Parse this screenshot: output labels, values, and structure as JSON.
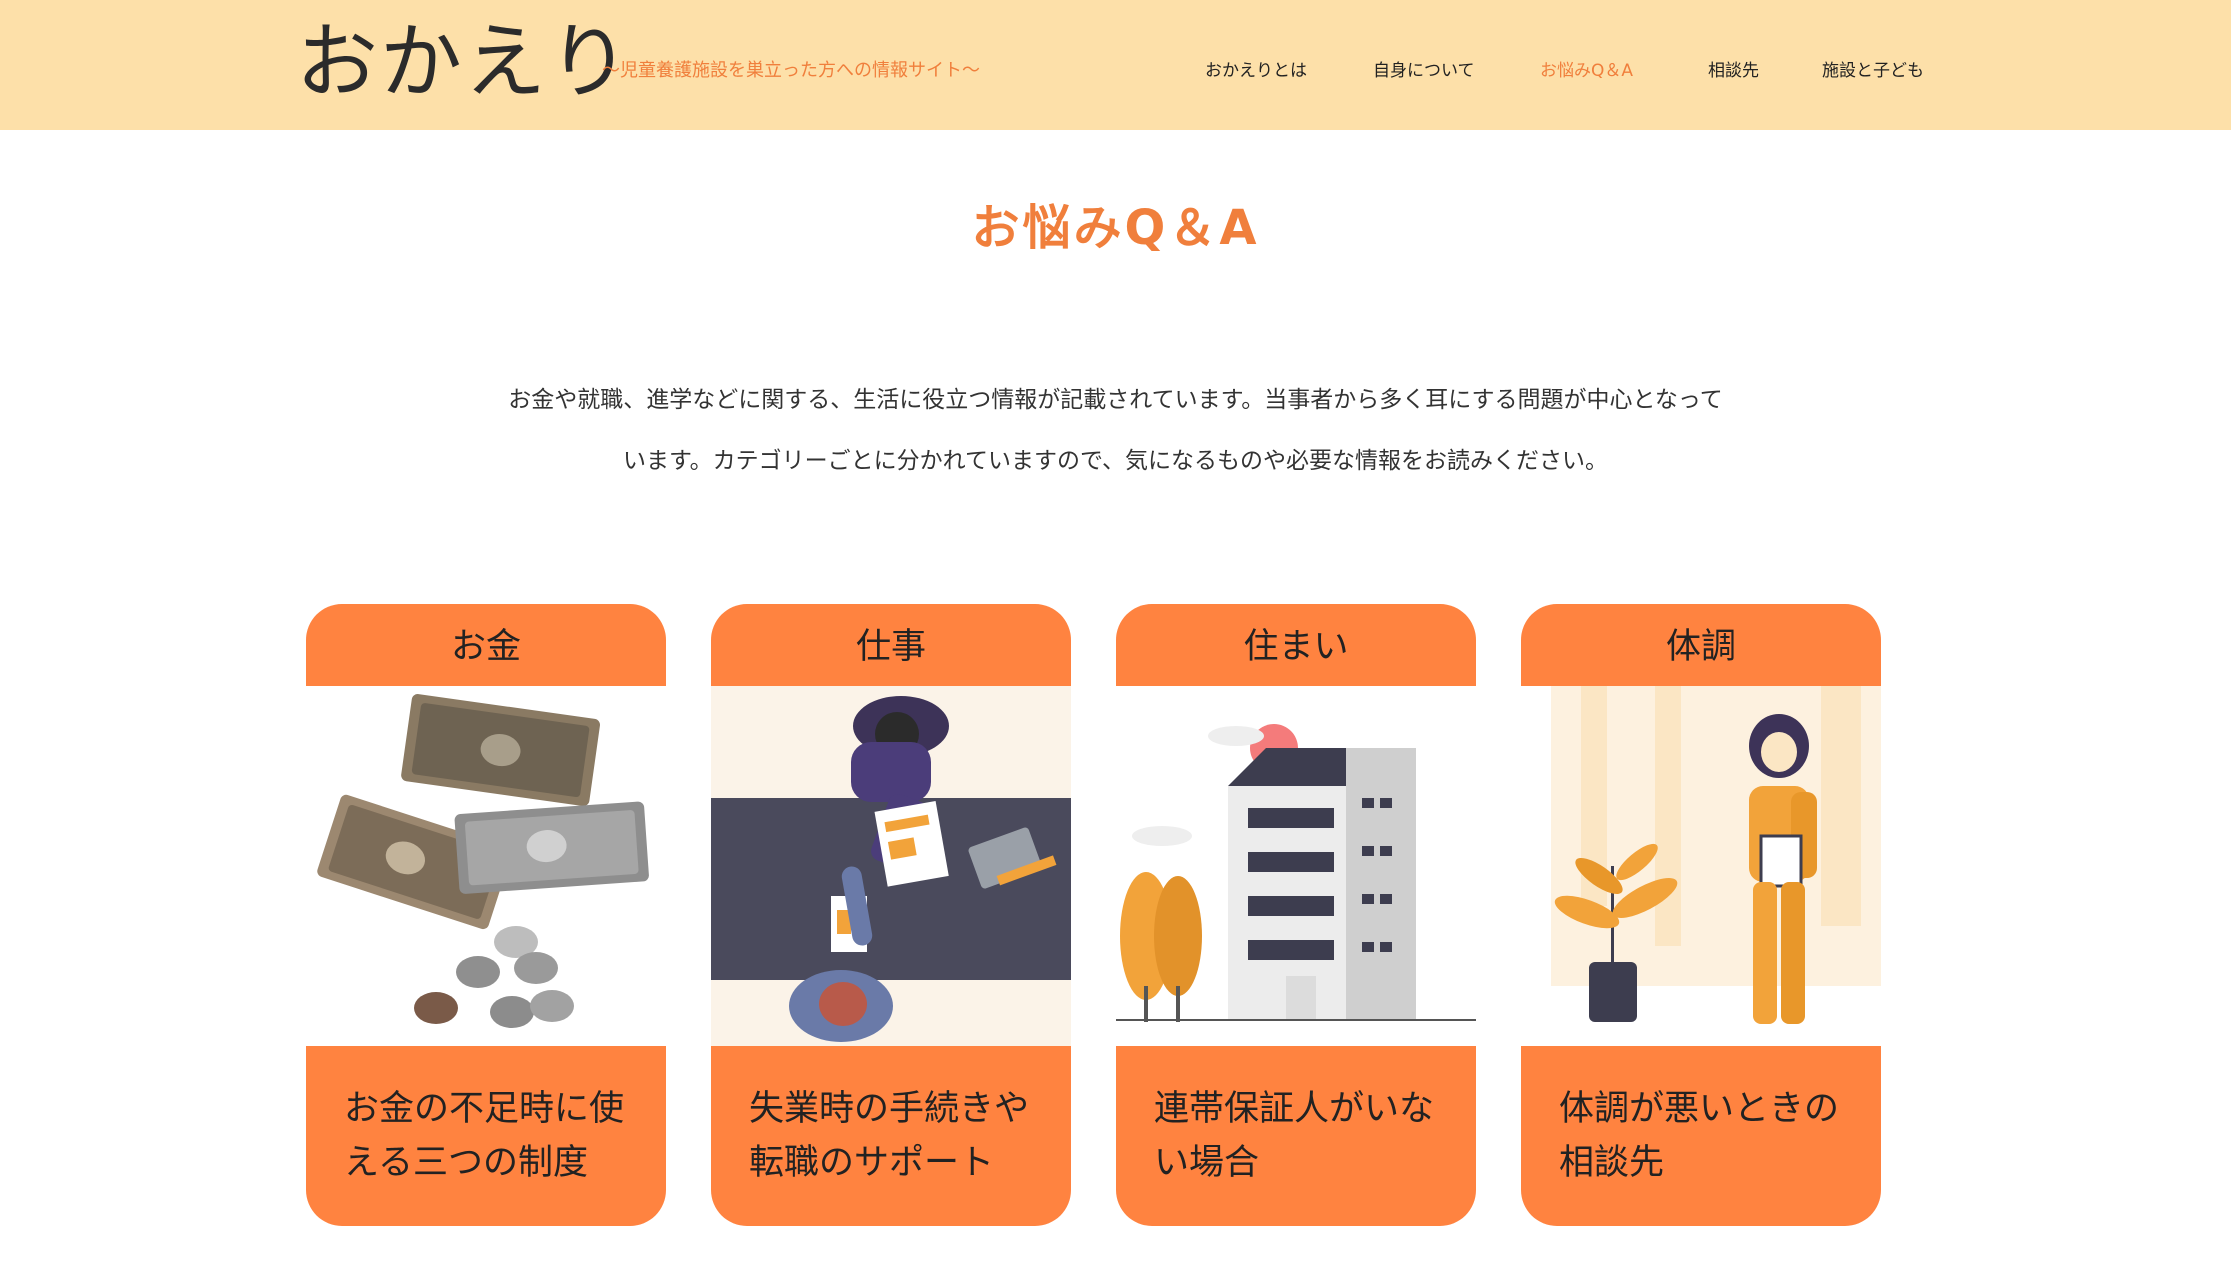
{
  "header": {
    "logo": "おかえり",
    "tagline": "〜児童養護施設を巣立った方への情報サイト〜",
    "nav": [
      {
        "label": "おかえりとは"
      },
      {
        "label": "自身について"
      },
      {
        "label": "お悩みQ＆A"
      },
      {
        "label": "相談先"
      },
      {
        "label": "施設と子ども"
      }
    ]
  },
  "page": {
    "title": "お悩みQ＆A",
    "intro_line1": "お金や就職、進学などに関する、生活に役立つ情報が記載されています。当事者から多く耳にする問題が中心となって",
    "intro_line2": "います。カテゴリーごとに分かれていますので、気になるものや必要な情報をお読みください。"
  },
  "cards": [
    {
      "category": "お金",
      "title_line1": "お金の不足時に使",
      "title_line2": "える三つの制度",
      "image": "money-illustration"
    },
    {
      "category": "仕事",
      "title_line1": "失業時の手続きや",
      "title_line2": "転職のサポート",
      "image": "handshake-illustration"
    },
    {
      "category": "住まい",
      "title_line1": "連帯保証人がいな",
      "title_line2": "い場合",
      "image": "building-illustration"
    },
    {
      "category": "体調",
      "title_line1": "体調が悪いときの",
      "title_line2": "相談先",
      "image": "nurse-illustration"
    }
  ],
  "colors": {
    "header_bg": "#fde0a9",
    "accent": "#f07f3c",
    "card_orange": "#ff8340"
  }
}
